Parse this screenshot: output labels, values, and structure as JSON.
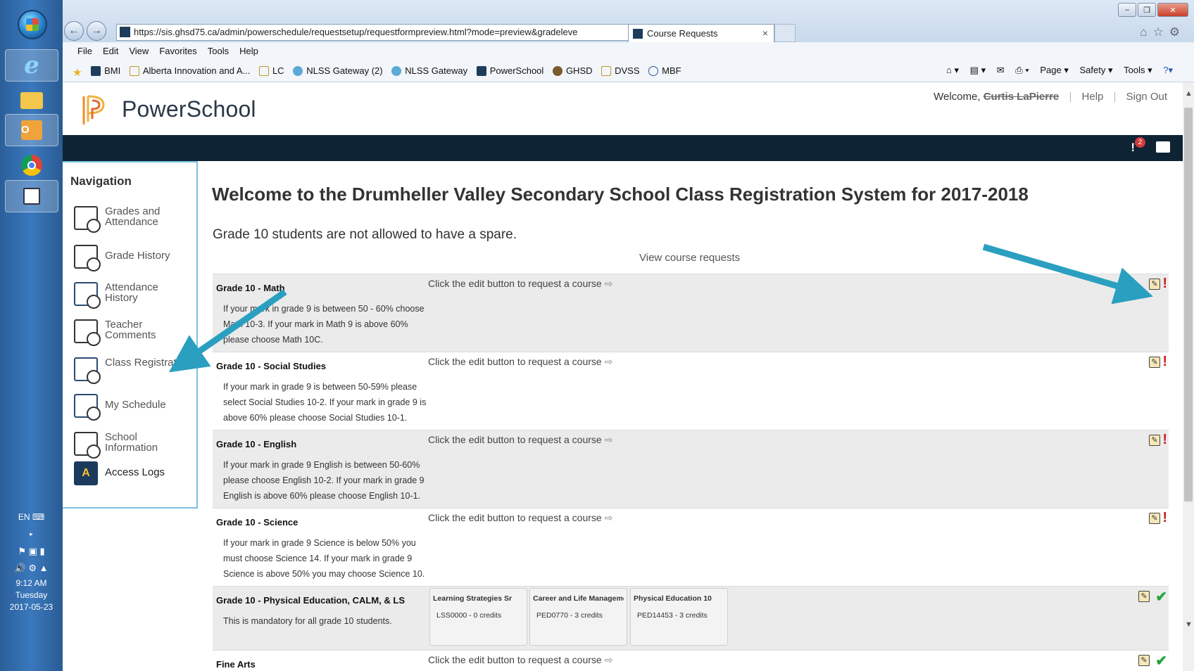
{
  "browser": {
    "url": "https://sis.ghsd75.ca/admin/powerschedule/requestsetup/requestformpreview.html?mode=preview&gradeleve",
    "tab_title": "Course Requests",
    "tab_close": "×",
    "menu": [
      "File",
      "Edit",
      "View",
      "Favorites",
      "Tools",
      "Help"
    ],
    "favorites": [
      "BMI",
      "Alberta Innovation and A...",
      "LC",
      "NLSS Gateway (2)",
      "NLSS Gateway",
      "PowerSchool",
      "GHSD",
      "DVSS",
      "MBF"
    ],
    "command_bar": [
      "Page ▾",
      "Safety ▾",
      "Tools ▾"
    ]
  },
  "taskbar": {
    "language": "EN",
    "time": "9:12 AM",
    "day": "Tuesday",
    "date": "2017-05-23"
  },
  "header": {
    "brand": "PowerSchool",
    "welcome": "Welcome,",
    "user": "Curtis LaPierre",
    "help": "Help",
    "sign_out": "Sign Out",
    "alert_count": "2"
  },
  "nav": {
    "title": "Navigation",
    "items": [
      "Grades and Attendance",
      "Grade History",
      "Attendance History",
      "Teacher Comments",
      "Class Registration",
      "My Schedule",
      "School Information",
      "Access Logs"
    ]
  },
  "main": {
    "title": "Welcome to the Drumheller Valley Secondary School Class Registration System for 2017-2018",
    "note": "Grade 10 students are not allowed to have a spare.",
    "view_requests": "View course requests",
    "prompt": "Click the edit button to request a course",
    "rows": [
      {
        "title": "Grade 10 - Math",
        "desc": "If your mark in grade 9 is between 50 - 60% choose Math 10-3. If your mark in Math 9 is above 60% please choose Math 10C.",
        "status": "!"
      },
      {
        "title": "Grade 10 - Social Studies",
        "desc": "If your mark in grade 9 is between 50-59% please select Social Studies 10-2. If your mark in grade 9 is above 60% please choose Social Studies 10-1.",
        "status": "!"
      },
      {
        "title": "Grade 10 - English",
        "desc": "If your mark in grade 9 English is between 50-60% please choose English 10-2. If your mark in grade 9 English is above 60% please choose English 10-1.",
        "status": "!"
      },
      {
        "title": "Grade 10 - Science",
        "desc": "If your mark in grade 9 Science is below 50% you must choose Science 14. If your mark in grade 9 Science is above 50% you may choose Science 10.",
        "status": "!"
      },
      {
        "title": "Grade 10 - Physical Education, CALM, & LS",
        "desc": "This is mandatory for all grade 10 students.",
        "status": "✔",
        "courses": [
          {
            "name": "Learning Strategies Sr",
            "code": "LSS0000 - 0 credits"
          },
          {
            "name": "Career and Life Management",
            "code": "PED0770 - 3 credits"
          },
          {
            "name": "Physical Education 10",
            "code": "PED14453 - 3 credits"
          }
        ]
      },
      {
        "title": "Fine Arts",
        "desc": "",
        "status": "✔"
      }
    ]
  },
  "colors": {
    "darkbar": "#0e2435",
    "sidebar_border": "#78c1e0",
    "annotation_arrow": "#2b9fc0",
    "warn": "#d01f1f",
    "ok": "#25a33b"
  }
}
